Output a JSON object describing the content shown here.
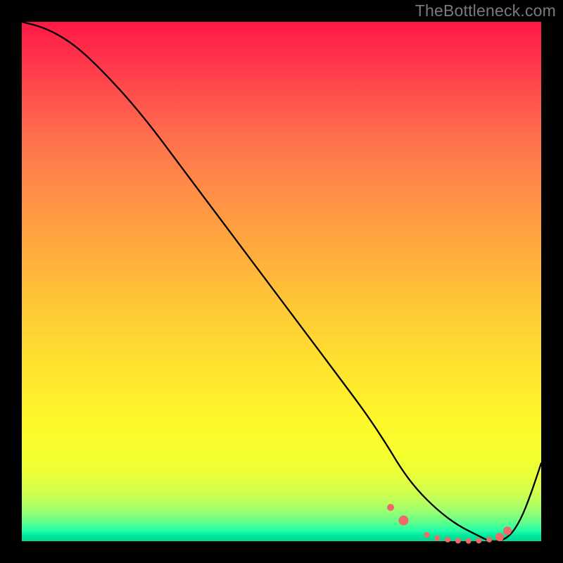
{
  "watermark": "TheBottleneck.com",
  "chart_data": {
    "type": "line",
    "title": "",
    "xlabel": "",
    "ylabel": "",
    "xlim": [
      0,
      100
    ],
    "ylim": [
      0,
      100
    ],
    "series": [
      {
        "name": "bottleneck-curve",
        "x": [
          0,
          4,
          8,
          12,
          18,
          24,
          30,
          36,
          42,
          48,
          54,
          60,
          66,
          70,
          73,
          76,
          80,
          84,
          88,
          90,
          92,
          94,
          96,
          98,
          100
        ],
        "y": [
          100,
          99,
          97,
          94,
          88,
          81,
          73,
          65,
          57,
          49,
          41,
          33,
          25,
          19,
          14,
          10,
          6,
          3,
          1,
          0,
          0,
          1,
          4,
          9,
          15
        ]
      }
    ],
    "highlight_points": {
      "name": "flat-region-markers",
      "color": "#ed6a66",
      "points": [
        {
          "x": 71,
          "y": 6.5,
          "r": 5
        },
        {
          "x": 73.5,
          "y": 4.0,
          "r": 7
        },
        {
          "x": 78,
          "y": 1.2,
          "r": 4
        },
        {
          "x": 80,
          "y": 0.6,
          "r": 4
        },
        {
          "x": 82,
          "y": 0.3,
          "r": 4
        },
        {
          "x": 84,
          "y": 0.1,
          "r": 4
        },
        {
          "x": 86,
          "y": 0.05,
          "r": 4
        },
        {
          "x": 88,
          "y": 0.1,
          "r": 4
        },
        {
          "x": 90,
          "y": 0.3,
          "r": 4
        },
        {
          "x": 92,
          "y": 0.8,
          "r": 6
        },
        {
          "x": 93.5,
          "y": 2.0,
          "r": 6
        }
      ]
    }
  }
}
